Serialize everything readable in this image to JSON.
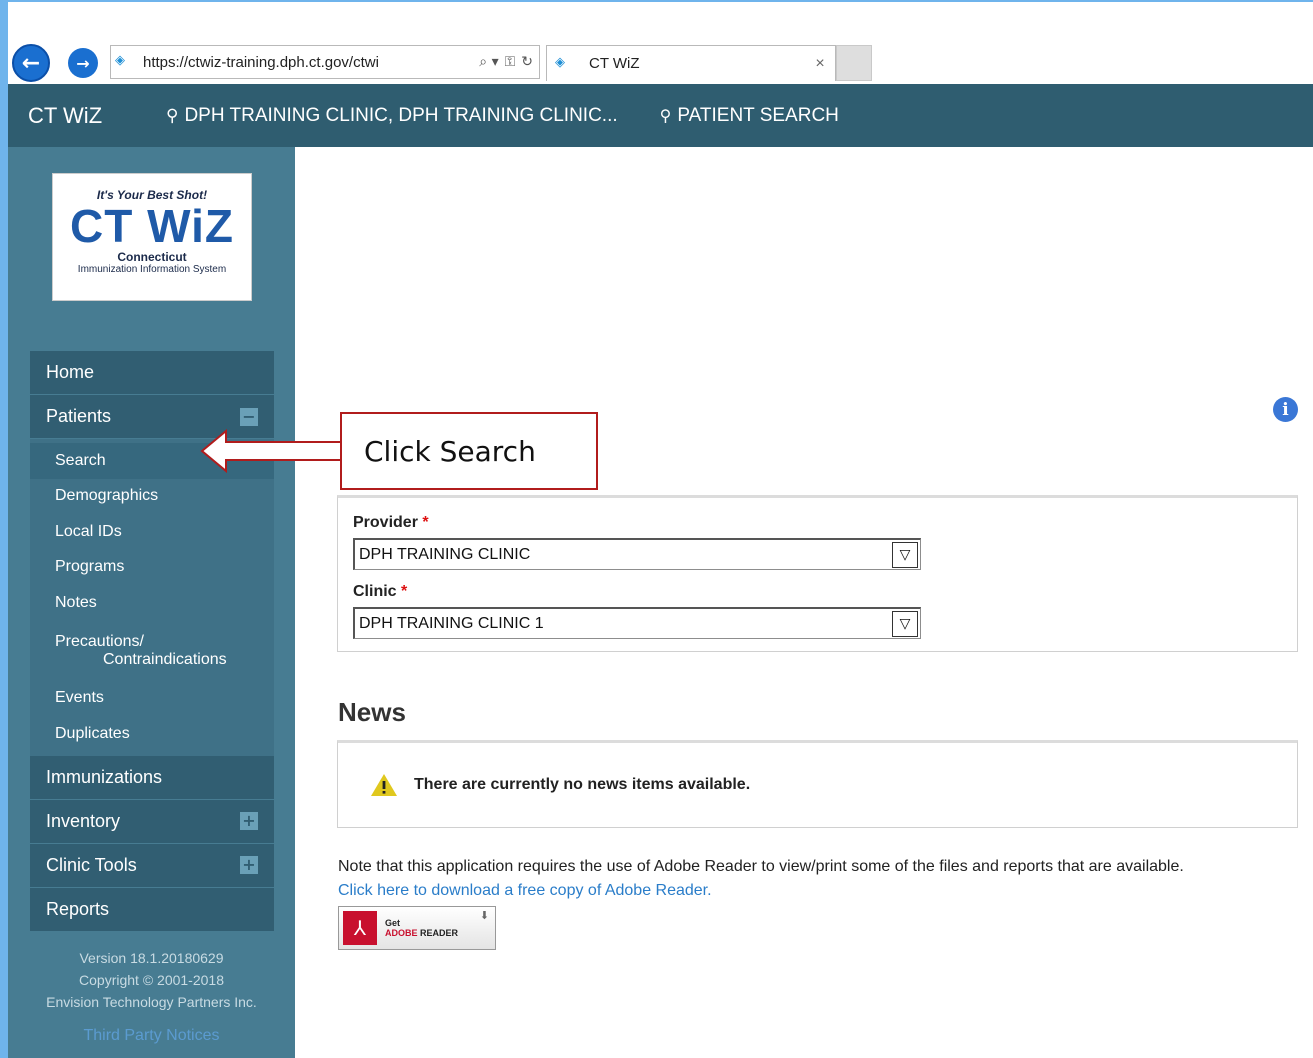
{
  "browser": {
    "url": "https://ctwiz-training.dph.ct.gov/ctwi",
    "tab_title": "CT WiZ",
    "tab_close": "×",
    "search_glyph": "⌕ ▾",
    "lock_glyph": "🔒",
    "refresh_glyph": "↻"
  },
  "header": {
    "brand": "CT WiZ",
    "location": "DPH TRAINING CLINIC, DPH TRAINING CLINIC...",
    "patient_search": "PATIENT SEARCH"
  },
  "logo": {
    "tagline": "It's Your Best Shot!",
    "name": "CT WiZ",
    "state": "Connecticut",
    "system": "Immunization Information System"
  },
  "sidebar": {
    "items": [
      {
        "label": "Home"
      },
      {
        "label": "Patients",
        "toggle": "−"
      },
      {
        "label": "Immunizations"
      },
      {
        "label": "Inventory",
        "toggle": "+"
      },
      {
        "label": "Clinic Tools",
        "toggle": "+"
      },
      {
        "label": "Reports"
      }
    ],
    "patients_sub": {
      "search": "Search",
      "demographics": "Demographics",
      "local_ids": "Local IDs",
      "programs": "Programs",
      "notes": "Notes",
      "precautions_1": "Precautions/",
      "precautions_2": "Contraindications",
      "events": "Events",
      "duplicates": "Duplicates"
    },
    "footer": {
      "version": "Version 18.1.20180629",
      "copyright": "Copyright © 2001-2018",
      "company": "Envision Technology Partners Inc."
    },
    "third_party": "Third Party Notices"
  },
  "form": {
    "provider_label": "Provider",
    "provider_value": "DPH TRAINING CLINIC",
    "clinic_label": "Clinic",
    "clinic_value": "DPH TRAINING CLINIC 1",
    "required_mark": "*"
  },
  "news": {
    "heading": "News",
    "message": "There are currently no news items available."
  },
  "note": {
    "text": "Note that this application requires the use of Adobe Reader to view/print some of the files and reports that are available.",
    "link": "Click here to download a free copy of Adobe Reader.",
    "badge_get": "Get",
    "badge_adobe": "ADOBE",
    "badge_reader": "READER"
  },
  "callout": {
    "text": "Click Search"
  },
  "colors": {
    "header_bg": "#2f5d70",
    "sidebar_bg": "#477c92",
    "menu_bg": "#315e72",
    "callout_border": "#b11c1c",
    "link": "#2a7dc9"
  }
}
